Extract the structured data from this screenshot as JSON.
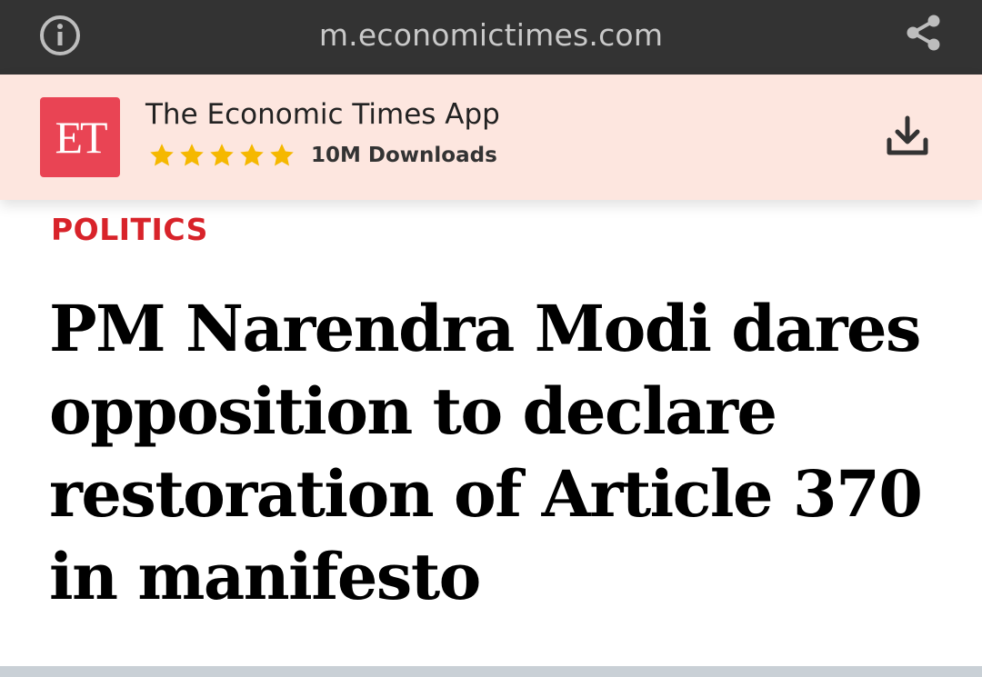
{
  "browser": {
    "url": "m.economictimes.com",
    "info_icon": "info-icon",
    "share_icon": "share-icon"
  },
  "app_banner": {
    "logo_text": "ET",
    "app_name": "The Economic Times App",
    "rating_stars": 5,
    "downloads": "10M Downloads",
    "download_icon": "download-icon",
    "colors": {
      "banner_bg": "#fde6df",
      "logo_bg": "#e94454",
      "star": "#f5b800"
    }
  },
  "article": {
    "category": "POLITICS",
    "headline": "PM Narendra Modi dares opposition to declare restoration of Article 370 in manifesto",
    "colors": {
      "category": "#d8232a"
    }
  }
}
